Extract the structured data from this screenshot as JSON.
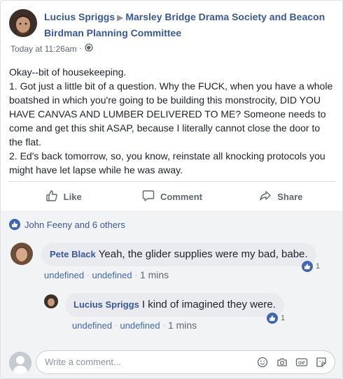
{
  "post": {
    "author": "Lucius Spriggs",
    "group": "Marsley Bridge Drama Society and Beacon Birdman Planning Committee",
    "timestamp": "Today at 11:26am",
    "privacy_icon": "globe-icon",
    "body": [
      "Okay--bit of housekeeping.",
      "1. Got just a little bit of a question. Why the FUCK, when you have a whole boatshed in which you're going to be building this monstrocity, DID YOU HAVE CANVAS AND LUMBER DELIVERED TO ME? Someone needs to come and get this shit ASAP, because I literally cannot close the door to the flat.",
      "2. Ed's back tomorrow, so, you know, reinstate all knocking protocols you might have let lapse while he was away."
    ]
  },
  "actions": {
    "like": "Like",
    "comment": "Comment",
    "share": "Share"
  },
  "reactions": {
    "summary": "John Feeny and 6 others"
  },
  "comments": [
    {
      "author": "Pete Black",
      "text": "Yeah, the glider supplies were my bad, babe.",
      "like_count": "1",
      "meta_a": "undefined",
      "meta_b": "undefined",
      "time": "1 mins"
    },
    {
      "author": "Lucius Spriggs",
      "text": "I kind of imagined they were.",
      "like_count": "1",
      "meta_a": "undefined",
      "meta_b": "undefined",
      "time": "1 mins"
    }
  ],
  "composer": {
    "placeholder": "Write a comment..."
  },
  "colors": {
    "link": "#385898",
    "accent": "#4267b2",
    "muted": "#616770",
    "bubble": "#e9ebee"
  }
}
